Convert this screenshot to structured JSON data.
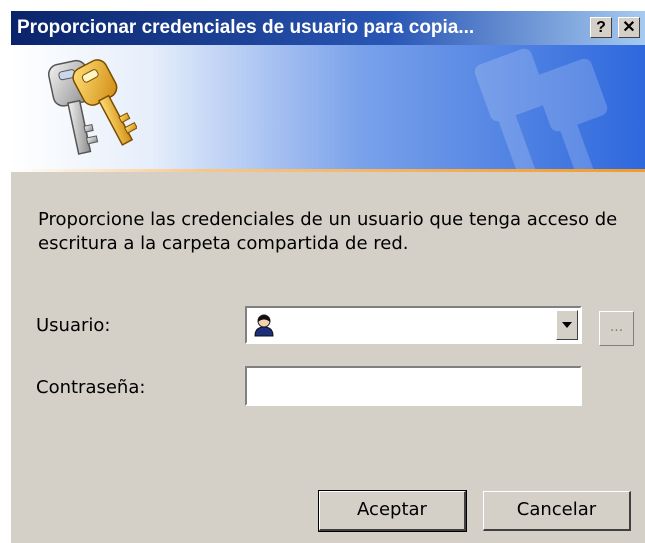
{
  "window": {
    "title": "Proporcionar credenciales de usuario para copia...",
    "help_button": "?",
    "close_button": "✕"
  },
  "banner": {
    "icon": "keys-icon"
  },
  "instructions": "Proporcione las credenciales de un usuario que tenga acceso de escritura a la carpeta compartida de red.",
  "form": {
    "user_label": "Usuario:",
    "user_value": "",
    "user_icon": "user-icon",
    "browse_label": "...",
    "password_label": "Contraseña:",
    "password_value": ""
  },
  "buttons": {
    "ok": "Aceptar",
    "cancel": "Cancelar"
  },
  "colors": {
    "titlebar": "#0a246a",
    "dialog_bg": "#d4d0c8",
    "accent_line": "#f39a28"
  }
}
